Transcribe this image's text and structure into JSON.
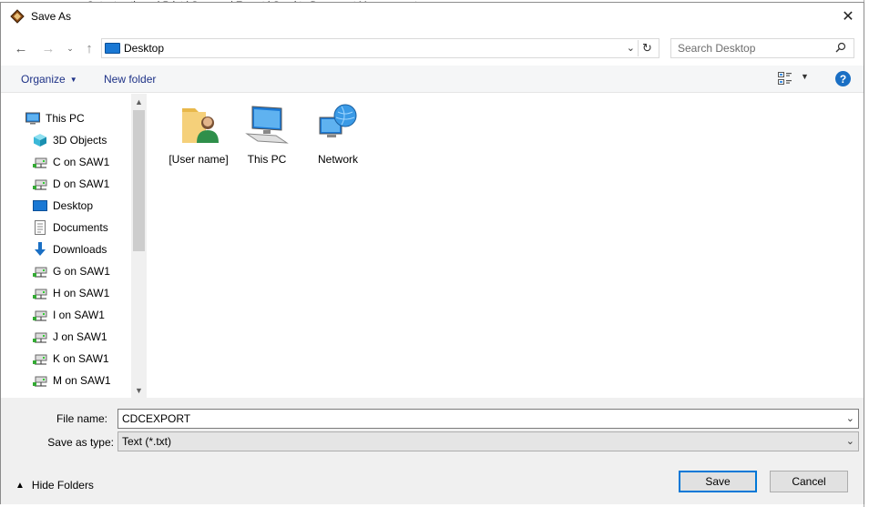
{
  "window": {
    "title": "Save As"
  },
  "background": {
    "strip_text": "Output options:  |  Print  |  Save as  |  Export  |  Send to Document Management"
  },
  "address": {
    "location": "Desktop"
  },
  "search": {
    "placeholder": "Search Desktop"
  },
  "toolbar": {
    "organize_label": "Organize",
    "new_folder_label": "New folder",
    "help_label": "?"
  },
  "sidebar": {
    "root_label": "This PC",
    "items": [
      {
        "label": "3D Objects",
        "icon": "3d-objects-icon"
      },
      {
        "label": "C on SAW1",
        "icon": "network-drive-icon"
      },
      {
        "label": "D on SAW1",
        "icon": "network-drive-icon"
      },
      {
        "label": "Desktop",
        "icon": "desktop-icon"
      },
      {
        "label": "Documents",
        "icon": "documents-icon"
      },
      {
        "label": "Downloads",
        "icon": "downloads-icon"
      },
      {
        "label": "G on SAW1",
        "icon": "network-drive-icon"
      },
      {
        "label": "H on SAW1",
        "icon": "network-drive-icon"
      },
      {
        "label": "I on SAW1",
        "icon": "network-drive-icon"
      },
      {
        "label": "J on SAW1",
        "icon": "network-drive-icon"
      },
      {
        "label": "K on SAW1",
        "icon": "network-drive-icon"
      },
      {
        "label": "M on SAW1",
        "icon": "network-drive-icon"
      }
    ]
  },
  "content": {
    "items": [
      {
        "label": "[User name]",
        "icon": "user-folder-icon"
      },
      {
        "label": "This PC",
        "icon": "computer-icon"
      },
      {
        "label": "Network",
        "icon": "network-icon"
      }
    ]
  },
  "form": {
    "file_name_label": "File name:",
    "file_name_value": "CDCEXPORT",
    "save_type_label": "Save as type:",
    "save_type_value": "Text (*.txt)"
  },
  "footer": {
    "hide_folders_label": "Hide Folders",
    "save_label": "Save",
    "cancel_label": "Cancel"
  },
  "colors": {
    "accent": "#0078d7",
    "link": "#1e3287",
    "help": "#1a6fc4"
  }
}
